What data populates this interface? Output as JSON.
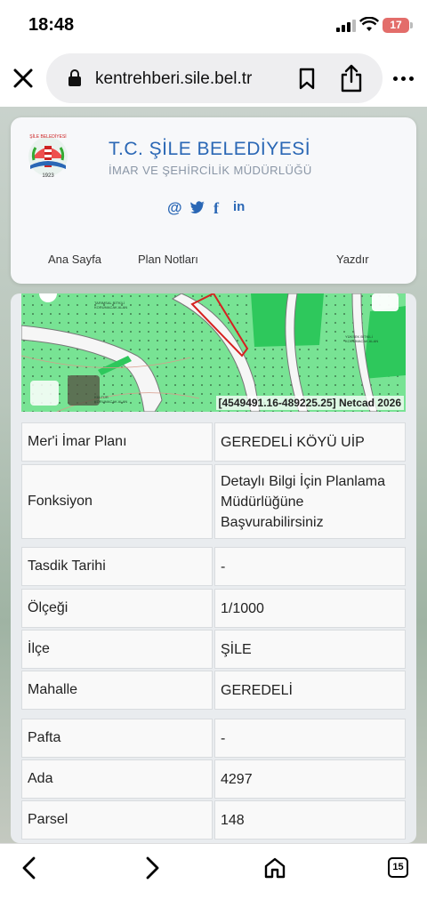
{
  "status": {
    "time": "18:48",
    "battery": "17"
  },
  "browser": {
    "url": "kentrehberi.sile.bel.tr",
    "tab_count": "15"
  },
  "header": {
    "title": "T.C. ŞİLE BELEDİYESİ",
    "subtitle": "İMAR VE ŞEHİRCİLİK MÜDÜRLÜĞÜ",
    "logo_year": "1923",
    "logo_text": "ŞİLE BELEDİYESİ",
    "social": [
      "@",
      "twitter-icon",
      "facebook-icon",
      "linkedin-icon"
    ],
    "nav": {
      "home": "Ana Sayfa",
      "plan_notes": "Plan Notları",
      "print": "Yazdır"
    }
  },
  "map": {
    "coords": "[4549491.16-489225.25] Netcad 2026",
    "labels": [
      "YÜKSEK BİTKİLİ KORUMACAK ALAN",
      "TARIMSAL BİTKİLİ KORUMACAK ALAN",
      "KÜLTÜR KORUMACAK ALAN"
    ]
  },
  "info": {
    "rows": [
      {
        "key": "Mer'i İmar Planı",
        "value": "GEREDELİ KÖYÜ UİP"
      },
      {
        "key": "Fonksiyon",
        "value": "Detaylı Bilgi İçin Planlama Müdürlüğüne Başvurabilirsiniz"
      },
      {
        "key": "Tasdik Tarihi",
        "value": "-"
      },
      {
        "key": "Ölçeği",
        "value": "1/1000"
      },
      {
        "key": "İlçe",
        "value": "ŞİLE"
      },
      {
        "key": "Mahalle",
        "value": "GEREDELİ"
      },
      {
        "key": "Pafta",
        "value": "-"
      },
      {
        "key": "Ada",
        "value": "4297"
      },
      {
        "key": "Parsel",
        "value": "148"
      }
    ]
  },
  "colors": {
    "brand": "#2a67b5",
    "map_green": "#6ddf8a",
    "parcel_red": "#d62020"
  }
}
